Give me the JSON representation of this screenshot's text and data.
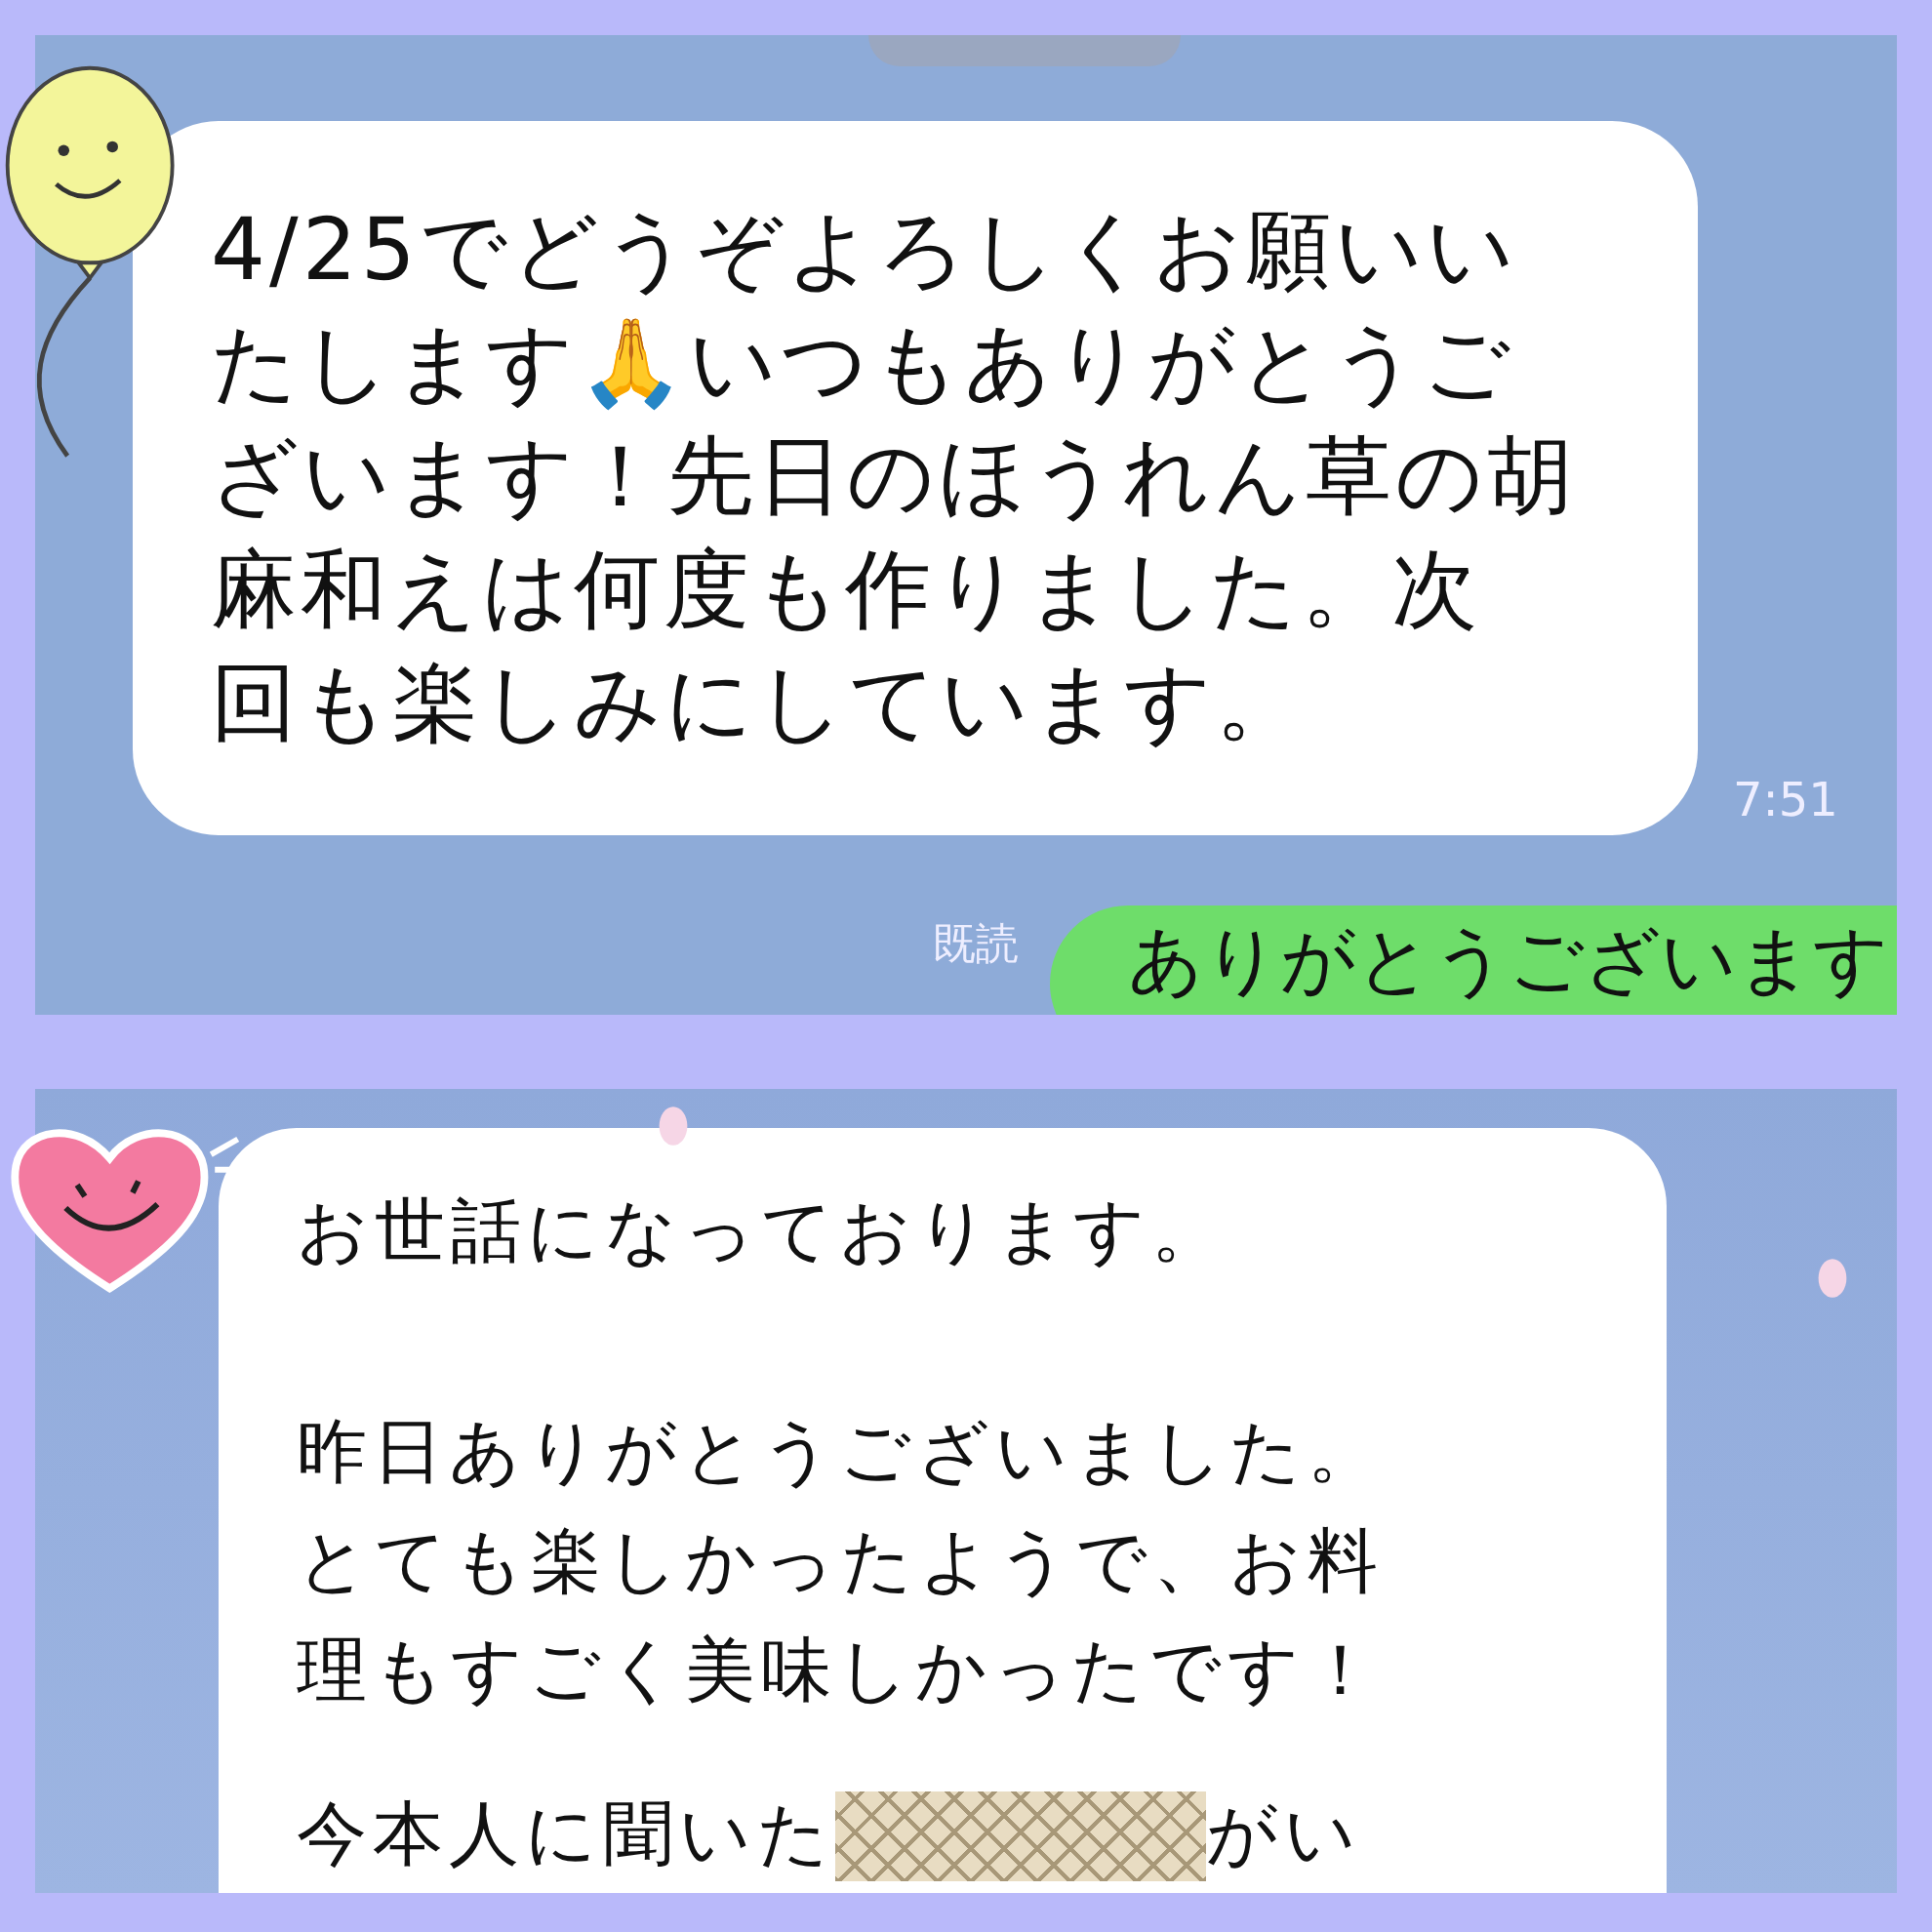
{
  "panels": [
    {
      "kind": "top",
      "incoming": {
        "lines": [
          "4/25でどうぞよろしくお願いい",
          "たします🙏いつもありがとうご",
          "ざいます！先日のほうれん草の胡",
          "麻和えは何度も作りました。次",
          "回も楽しみにしています。"
        ],
        "time": "7:51"
      },
      "outgoing": {
        "read": "既読",
        "text": "ありがとうございます"
      }
    },
    {
      "kind": "bottom",
      "incoming": {
        "paragraphs": [
          [
            "お世話になっております。"
          ],
          [
            "昨日ありがとうございました。",
            "とても楽しかったようで、お料",
            "理もすごく美味しかったです！"
          ]
        ],
        "last_line": {
          "before": "今本人に聞いた",
          "after": "がい"
        }
      }
    }
  ]
}
